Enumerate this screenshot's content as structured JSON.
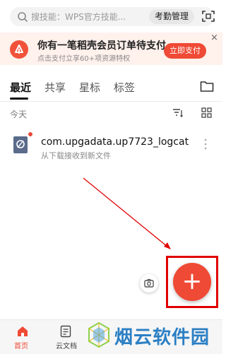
{
  "search": {
    "placeholder": "搜技能：WPS官方技能...",
    "tag": "考勤管理"
  },
  "banner": {
    "title": "你有一笔稻壳会员订单待支付",
    "subtitle": "点击支付立享60+项资源特权",
    "pay_label": "立即支付",
    "close": "×"
  },
  "tabs": [
    "最近",
    "共享",
    "星标",
    "标签"
  ],
  "section": {
    "today": "今天"
  },
  "file": {
    "name": "com.upgadata.up7723_logcat",
    "subtitle": "从下载接收到新文件"
  },
  "fab": {
    "label": "+"
  },
  "bottom_nav": [
    "首页",
    "云文档"
  ],
  "watermark": "烟云软件园",
  "colors": {
    "accent": "#ef4a36",
    "highlight": "#e00000",
    "watermark": "#2b7fc4"
  }
}
